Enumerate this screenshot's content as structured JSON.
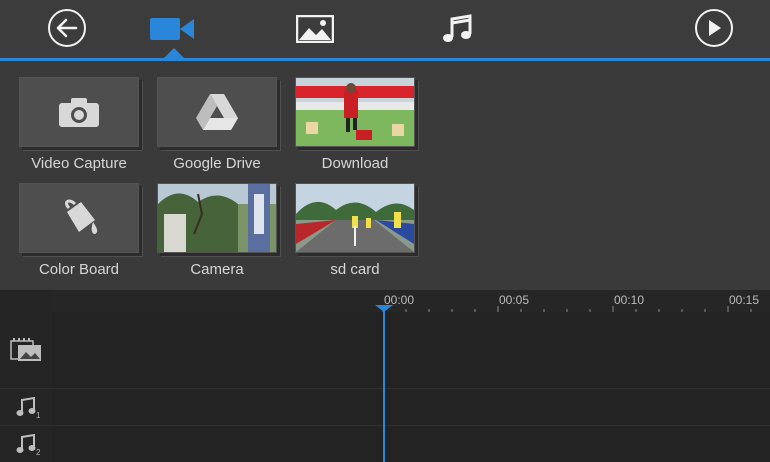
{
  "toolbar": {
    "back_icon": "back-arrow-icon",
    "video_tab_icon": "video-camera-icon",
    "image_tab_icon": "image-icon",
    "music_tab_icon": "music-note-icon",
    "play_icon": "play-icon",
    "accent_color": "#2a86d8"
  },
  "sources": [
    {
      "label": "Video Capture",
      "icon": "camera-icon"
    },
    {
      "label": "Google Drive",
      "icon": "google-drive-icon"
    },
    {
      "label": "Download",
      "icon": "download-thumbnail"
    },
    {
      "label": "Color Board",
      "icon": "paint-bucket-icon"
    },
    {
      "label": "Camera",
      "icon": "camera-thumbnail"
    },
    {
      "label": "sd card",
      "icon": "sd-card-thumbnail"
    }
  ],
  "timeline": {
    "ticks": [
      "00:00",
      "00:05",
      "00:10",
      "00:15"
    ],
    "tracks": [
      {
        "icon": "video-image-track-icon",
        "sub": ""
      },
      {
        "icon": "music-track-icon",
        "sub": "1"
      },
      {
        "icon": "music-track-icon",
        "sub": "2"
      }
    ]
  }
}
